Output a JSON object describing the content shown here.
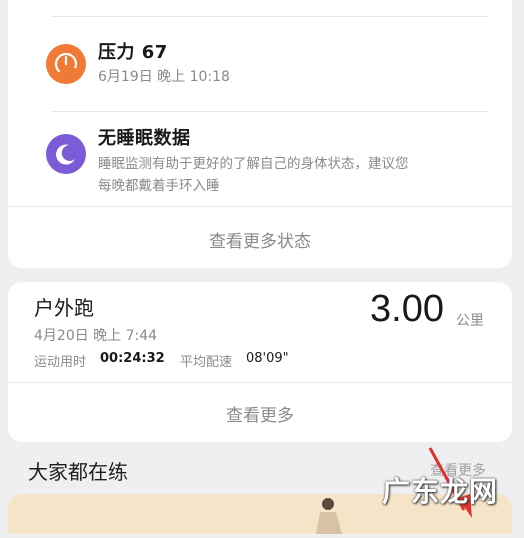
{
  "status_card": {
    "stress": {
      "title": "压力 67",
      "time": "6月19日 晚上 10:18",
      "icon": "gauge-icon",
      "color": "#f07a35"
    },
    "sleep": {
      "title": "无睡眠数据",
      "desc_line1": "睡眠监测有助于更好的了解自己的身体状态，建议您",
      "desc_line2": "每晚都戴着手环入睡",
      "icon": "moon-icon",
      "color": "#7b5cd6"
    },
    "more_label": "查看更多状态"
  },
  "workout_card": {
    "title": "户外跑",
    "distance": "3.00",
    "unit": "公里",
    "time": "4月20日 晚上 7:44",
    "duration_label": "运动用时",
    "duration": "00:24:32",
    "pace_label": "平均配速",
    "pace": "08'09\"",
    "more_label": "查看更多"
  },
  "community": {
    "title": "大家都在练",
    "more_label": "查看更多"
  },
  "watermark": "广东龙网"
}
